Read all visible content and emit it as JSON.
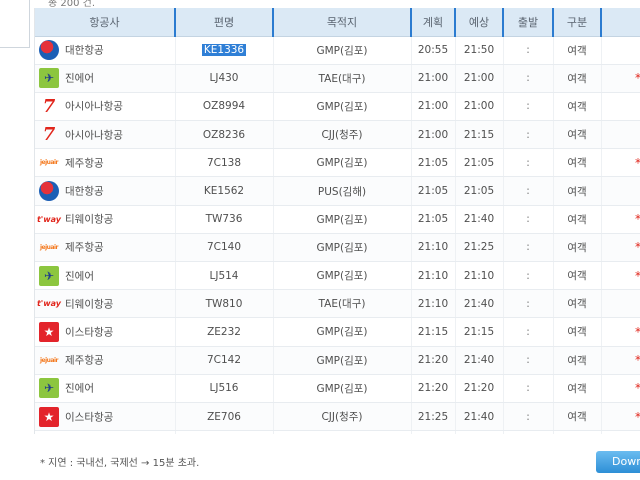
{
  "header_note": "총 200 건.",
  "columns": [
    "항공사",
    "편명",
    "목적지",
    "계획",
    "예상",
    "출발",
    "구분",
    ""
  ],
  "rows": [
    {
      "logo": "korean-air-logo",
      "airline": "대한항공",
      "flight": "KE1336",
      "dest": "GMP(김포)",
      "plan": "20:55",
      "est": "21:50",
      "dep": ":",
      "type": "여객",
      "remark": "",
      "selected": true
    },
    {
      "logo": "jin-air-logo",
      "airline": "진에어",
      "flight": "LJ430",
      "dest": "TAE(대구)",
      "plan": "21:00",
      "est": "21:00",
      "dep": ":",
      "type": "여객",
      "remark": "*"
    },
    {
      "logo": "asiana-logo",
      "airline": "아시아나항공",
      "flight": "OZ8994",
      "dest": "GMP(김포)",
      "plan": "21:00",
      "est": "21:00",
      "dep": ":",
      "type": "여객",
      "remark": ""
    },
    {
      "logo": "asiana-logo",
      "airline": "아시아나항공",
      "flight": "OZ8236",
      "dest": "CJJ(청주)",
      "plan": "21:00",
      "est": "21:15",
      "dep": ":",
      "type": "여객",
      "remark": ""
    },
    {
      "logo": "jeju-air-logo",
      "airline": "제주항공",
      "flight": "7C138",
      "dest": "GMP(김포)",
      "plan": "21:05",
      "est": "21:05",
      "dep": ":",
      "type": "여객",
      "remark": "*"
    },
    {
      "logo": "korean-air-logo",
      "airline": "대한항공",
      "flight": "KE1562",
      "dest": "PUS(김해)",
      "plan": "21:05",
      "est": "21:05",
      "dep": ":",
      "type": "여객",
      "remark": ""
    },
    {
      "logo": "tway-logo",
      "airline": "티웨이항공",
      "flight": "TW736",
      "dest": "GMP(김포)",
      "plan": "21:05",
      "est": "21:40",
      "dep": ":",
      "type": "여객",
      "remark": "*"
    },
    {
      "logo": "jeju-air-logo",
      "airline": "제주항공",
      "flight": "7C140",
      "dest": "GMP(김포)",
      "plan": "21:10",
      "est": "21:25",
      "dep": ":",
      "type": "여객",
      "remark": "*"
    },
    {
      "logo": "jin-air-logo",
      "airline": "진에어",
      "flight": "LJ514",
      "dest": "GMP(김포)",
      "plan": "21:10",
      "est": "21:10",
      "dep": ":",
      "type": "여객",
      "remark": "*"
    },
    {
      "logo": "tway-logo",
      "airline": "티웨이항공",
      "flight": "TW810",
      "dest": "TAE(대구)",
      "plan": "21:10",
      "est": "21:40",
      "dep": ":",
      "type": "여객",
      "remark": ""
    },
    {
      "logo": "eastar-logo",
      "airline": "이스타항공",
      "flight": "ZE232",
      "dest": "GMP(김포)",
      "plan": "21:15",
      "est": "21:15",
      "dep": ":",
      "type": "여객",
      "remark": "*"
    },
    {
      "logo": "jeju-air-logo",
      "airline": "제주항공",
      "flight": "7C142",
      "dest": "GMP(김포)",
      "plan": "21:20",
      "est": "21:40",
      "dep": ":",
      "type": "여객",
      "remark": "*"
    },
    {
      "logo": "jin-air-logo",
      "airline": "진에어",
      "flight": "LJ516",
      "dest": "GMP(김포)",
      "plan": "21:20",
      "est": "21:20",
      "dep": ":",
      "type": "여객",
      "remark": "*"
    },
    {
      "logo": "eastar-logo",
      "airline": "이스타항공",
      "flight": "ZE706",
      "dest": "CJJ(청주)",
      "plan": "21:25",
      "est": "21:40",
      "dep": ":",
      "type": "여객",
      "remark": "*"
    },
    {
      "logo": "jin-air-logo",
      "airline": "",
      "flight": "",
      "dest": "",
      "plan": "",
      "est": "",
      "dep": "",
      "type": "",
      "remark": ""
    }
  ],
  "footnote": "* 지연 : 국내선, 국제선 → 15분 초과.",
  "download_label": "Download",
  "colors": {
    "header_bg": "#dbe9f5",
    "header_divider": "#2b7bd0",
    "accent_blue": "#2d8fd6",
    "remark_red": "#e1251b"
  }
}
